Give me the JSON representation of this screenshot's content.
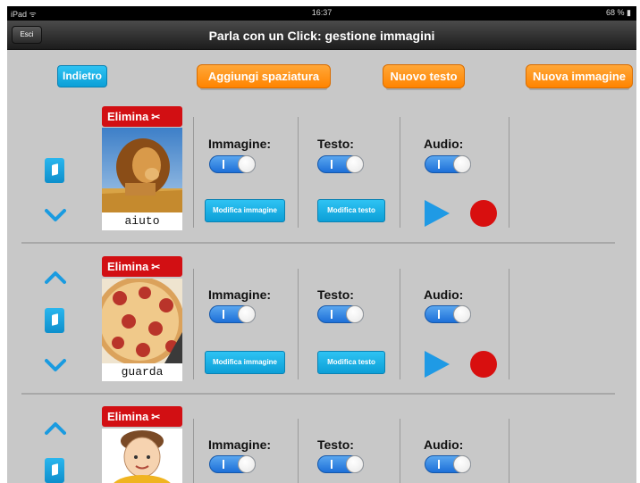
{
  "status_bar": {
    "device": "iPad ᯤ",
    "time": "16:37",
    "battery": "68 % ▮"
  },
  "nav": {
    "exit_label": "Esci",
    "title": "Parla con un Click: gestione immagini"
  },
  "toolbar": {
    "back_label": "Indietro",
    "add_space_label": "Aggiungi spaziatura",
    "new_text_label": "Nuovo testo",
    "new_image_label": "Nuova immagine"
  },
  "rows": [
    {
      "delete_label": "Elimina",
      "image_icon": "lion",
      "caption": "aiuto",
      "image_label": "Immagine:",
      "text_label": "Testo:",
      "audio_label": "Audio:",
      "edit_image_label": "Modifica immagine",
      "edit_text_label": "Modifica testo",
      "image_on": true,
      "text_on": true,
      "audio_on": true
    },
    {
      "delete_label": "Elimina",
      "image_icon": "pizza",
      "caption": "guarda",
      "image_label": "Immagine:",
      "text_label": "Testo:",
      "audio_label": "Audio:",
      "edit_image_label": "Modifica immagine",
      "edit_text_label": "Modifica testo",
      "image_on": true,
      "text_on": true,
      "audio_on": true
    },
    {
      "delete_label": "Elimina",
      "image_icon": "child",
      "caption": "",
      "image_label": "Immagine:",
      "text_label": "Testo:",
      "audio_label": "Audio:",
      "image_on": true,
      "text_on": true,
      "audio_on": true
    }
  ],
  "colors": {
    "accent_blue": "#1199d8",
    "accent_orange": "#ff8c0a",
    "delete_red": "#d20f13",
    "record_red": "#d80f0f",
    "background": "#c8c8c8"
  }
}
